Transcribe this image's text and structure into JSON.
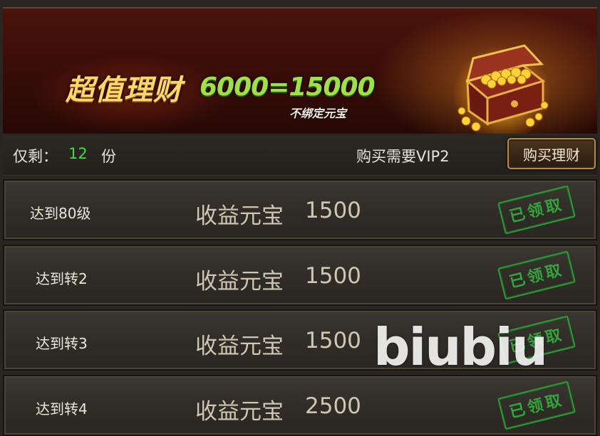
{
  "banner": {
    "title": "超值理财",
    "formula": "6000=15000",
    "subtitle": "不绑定元宝",
    "chest_icon": "treasure-chest-icon"
  },
  "info": {
    "remaining_label": "仅剩：",
    "remaining_count": "12",
    "remaining_unit": "份",
    "vip_requirement": "购买需要VIP2",
    "buy_button": "购买理财"
  },
  "rows": [
    {
      "condition": "达到80级",
      "reward_label": "收益元宝",
      "reward_value": "1500",
      "status": "已领取"
    },
    {
      "condition": "达到转2",
      "reward_label": "收益元宝",
      "reward_value": "1500",
      "status": "已领取"
    },
    {
      "condition": "达到转3",
      "reward_label": "收益元宝",
      "reward_value": "1500",
      "status": "已领取"
    },
    {
      "condition": "达到转4",
      "reward_label": "收益元宝",
      "reward_value": "2500",
      "status": "已领取"
    }
  ],
  "watermark": "biubiu",
  "colors": {
    "accent_green": "#3fdc3f",
    "stamp_green": "#35b040",
    "title_gold": "#ffd76a",
    "formula_green": "#9fe04a"
  }
}
